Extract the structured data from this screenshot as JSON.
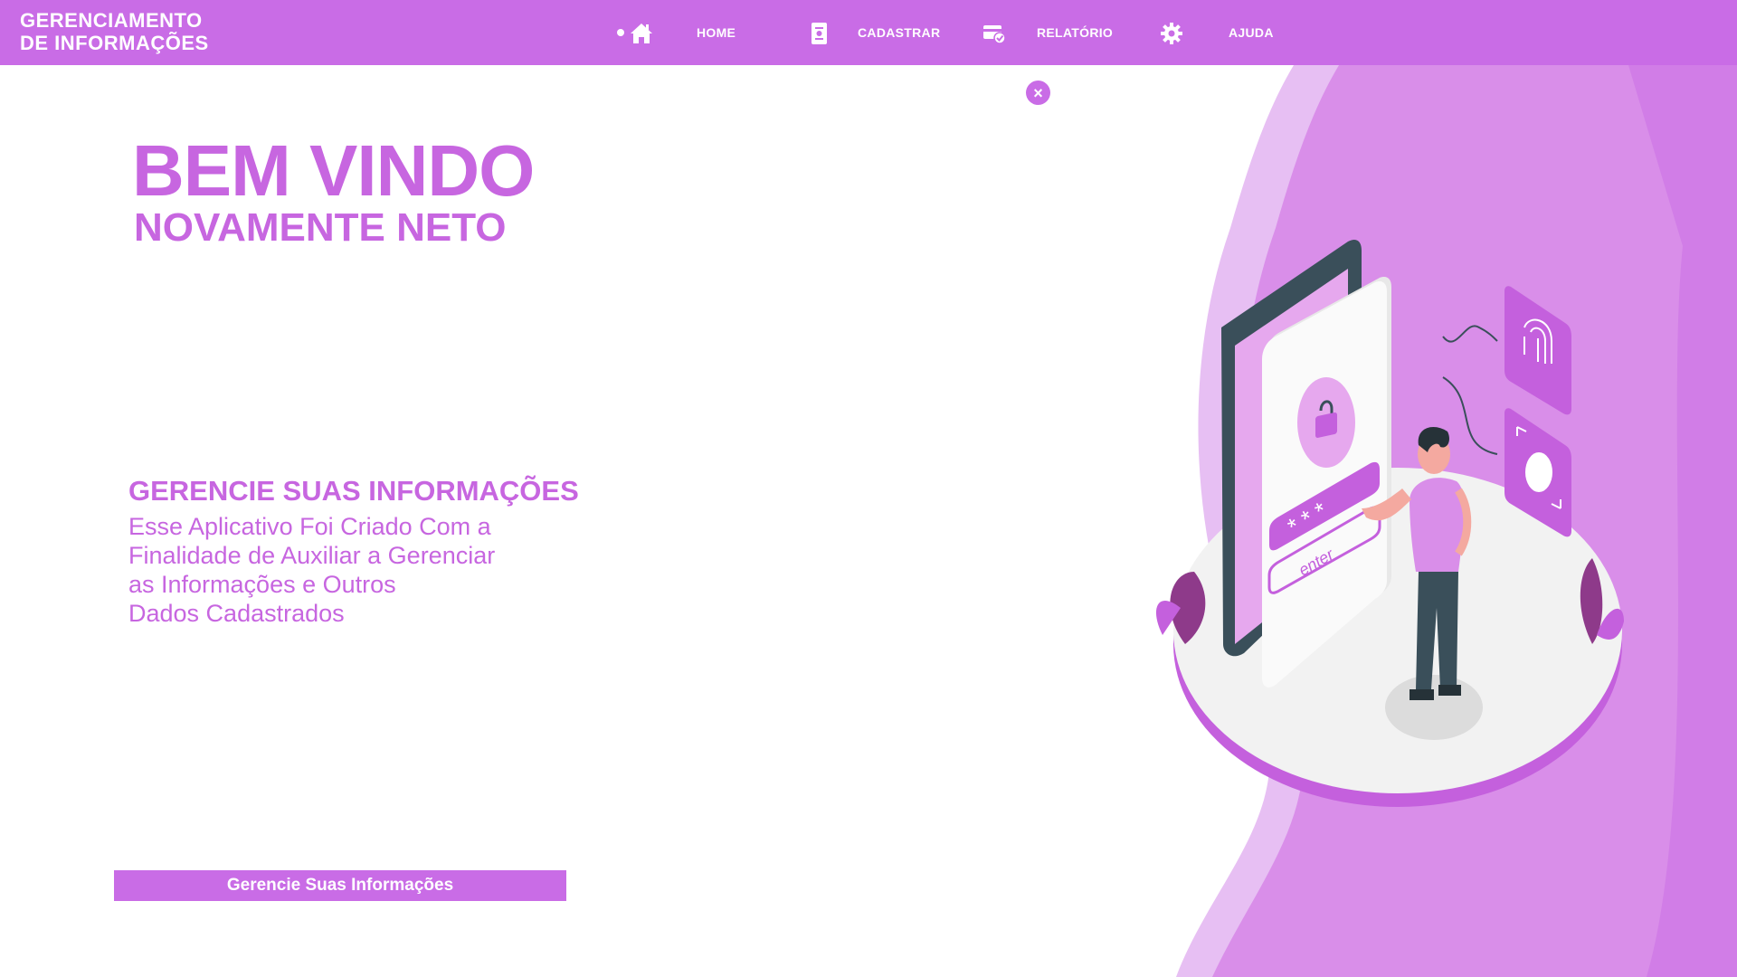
{
  "app": {
    "title_line1": "GERENCIAMENTO",
    "title_line2": "DE INFORMAÇÕES"
  },
  "nav": {
    "home": "HOME",
    "cadastrar": "CADASTRAR",
    "relatorio": "RELATÓRIO",
    "ajuda": "AJUDA"
  },
  "hero": {
    "title": "BEM VINDO",
    "subtitle": "NOVAMENTE NETO"
  },
  "info": {
    "title": "GERENCIE SUAS INFORMAÇÕES",
    "lines": [
      "Esse Aplicativo Foi Criado Com a",
      "Finalidade de Auxiliar a Gerenciar",
      "as Informações e Outros",
      "Dados Cadastrados"
    ]
  },
  "cta": {
    "label": "Gerencie Suas Informações"
  },
  "illustration": {
    "enter_text": "enter"
  },
  "colors": {
    "accent": "#c96ce6",
    "text_accent": "#c766e0",
    "light_accent": "#e3b3f1"
  },
  "icons": [
    "home-icon",
    "document-icon",
    "card-check-icon",
    "gear-icon",
    "close-icon",
    "lock-icon",
    "fingerprint-icon",
    "face-id-icon"
  ]
}
